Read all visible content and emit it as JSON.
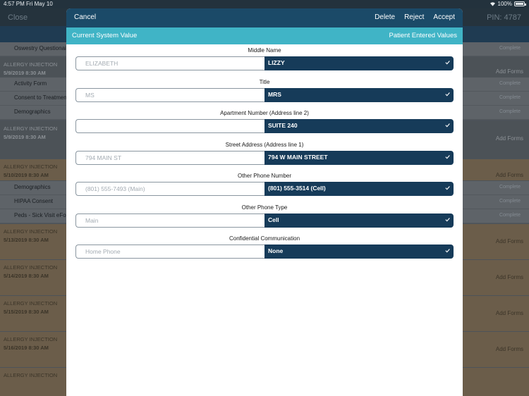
{
  "statusbar": {
    "time": "4:57 PM   Fri May 10",
    "battery": "100%"
  },
  "app": {
    "close_label": "Close",
    "pin": "PIN: 4787",
    "list": [
      {
        "type": "sub",
        "label": "Oswestry Questionaire",
        "status": "Complete"
      },
      {
        "type": "head",
        "tan": false,
        "title": "ALLERGY INJECTION",
        "date": "5/9/2019 8:30 AM",
        "add": "Add Forms"
      },
      {
        "type": "sub",
        "label": "Activity Form",
        "status": "Complete"
      },
      {
        "type": "sub",
        "label": "Consent to Treatment",
        "status": "Complete"
      },
      {
        "type": "sub",
        "label": "Demographics",
        "status": "Complete"
      },
      {
        "type": "head",
        "tan": false,
        "title": "ALLERGY INJECTION",
        "date": "5/9/2019 8:30 AM",
        "add": "Add Forms"
      },
      {
        "type": "head",
        "tan": true,
        "title": "ALLERGY INJECTION",
        "date": "5/10/2019 8:30 AM",
        "add": "Add Forms"
      },
      {
        "type": "sub",
        "label": "Demographics",
        "status": "Complete"
      },
      {
        "type": "sub",
        "label": "HIPAA Consent",
        "status": "Complete"
      },
      {
        "type": "sub",
        "label": "Peds - Sick Visit eForm",
        "status": "Complete"
      },
      {
        "type": "head",
        "tan": true,
        "title": "ALLERGY INJECTION",
        "date": "5/13/2019 8:30 AM",
        "add": "Add Forms"
      },
      {
        "type": "head",
        "tan": true,
        "title": "ALLERGY INJECTION",
        "date": "5/14/2019 8:30 AM",
        "add": "Add Forms"
      },
      {
        "type": "head",
        "tan": true,
        "title": "ALLERGY INJECTION",
        "date": "5/15/2019 8:30 AM",
        "add": "Add Forms"
      },
      {
        "type": "head",
        "tan": true,
        "title": "ALLERGY INJECTION",
        "date": "5/16/2019 8:30 AM",
        "add": "Add Forms"
      },
      {
        "type": "head",
        "tan": true,
        "title": "ALLERGY INJECTION",
        "date": "",
        "add": ""
      }
    ]
  },
  "modal": {
    "cancel_label": "Cancel",
    "delete_label": "Delete",
    "reject_label": "Reject",
    "accept_label": "Accept",
    "current_label": "Current System Value",
    "patient_label": "Patient Entered Values",
    "fields": [
      {
        "label": "Middle Name",
        "system": "ELIZABETH",
        "patient": "LIZZY"
      },
      {
        "label": "Title",
        "system": "MS",
        "patient": "MRS"
      },
      {
        "label": "Apartment Number (Address line 2)",
        "system": "",
        "patient": "SUITE 240"
      },
      {
        "label": "Street Address (Address line 1)",
        "system": "794 MAIN ST",
        "patient": "794 W MAIN STREET"
      },
      {
        "label": "Other Phone Number",
        "system": "(801) 555-7493 (Main)",
        "patient": "(801) 555-3514 (Cell)"
      },
      {
        "label": "Other Phone Type",
        "system": "Main",
        "patient": "Cell"
      },
      {
        "label": "Confidential Communication",
        "system": "Home Phone",
        "patient": "None"
      }
    ]
  },
  "colors": {
    "header": "#1b4a68",
    "subheader": "#40b4c6",
    "patient_value_bg": "#163b59"
  }
}
